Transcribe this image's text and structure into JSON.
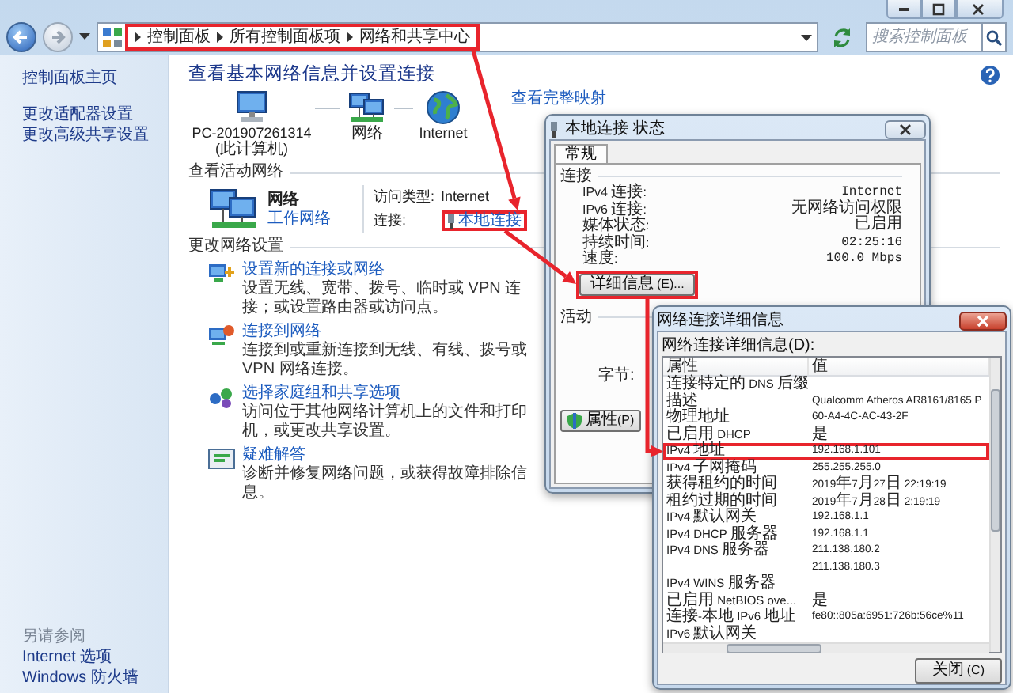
{
  "address_bar": {
    "breadcrumbs": [
      "控制面板",
      "所有控制面板项",
      "网络和共享中心"
    ],
    "highlighted": true
  },
  "search": {
    "placeholder": "搜索控制面板"
  },
  "sidebar": {
    "items": [
      "控制面板主页",
      "更改适配器设置",
      "更改高级共享设置"
    ],
    "see_also_title": "另请参阅",
    "see_also": [
      "Internet 选项",
      "Windows 防火墙"
    ]
  },
  "main": {
    "heading": "查看基本网络信息并设置连接",
    "map_link": "查看完整映射",
    "map_nodes": [
      {
        "kind": "computer",
        "label": [
          "PC-201907261314",
          "(此计算机)"
        ]
      },
      {
        "kind": "network",
        "label": [
          "网络"
        ]
      },
      {
        "kind": "internet",
        "label": [
          "Internet"
        ]
      }
    ],
    "active_networks": {
      "title": "查看活动网络",
      "network_name": "网络",
      "network_type": "工作网络",
      "access_label": "访问类型:",
      "access_value": "Internet",
      "connection_label": "连接:",
      "connection_value": "本地连接",
      "connection_highlighted": true
    },
    "change_settings": {
      "title": "更改网络设置",
      "tasks": [
        {
          "kind": "new-connection",
          "title": "设置新的连接或网络",
          "description": "设置无线、宽带、拨号、临时或 VPN 连接；或设置路由器或访问点。"
        },
        {
          "kind": "connect",
          "title": "连接到网络",
          "description": "连接到或重新连接到无线、有线、拨号或 VPN 网络连接。"
        },
        {
          "kind": "homegroup",
          "title": "选择家庭组和共享选项",
          "description": "访问位于其他网络计算机上的文件和打印机，或更改共享设置。"
        },
        {
          "kind": "troubleshoot",
          "title": "疑难解答",
          "description": "诊断并修复网络问题，或获得故障排除信息。"
        }
      ]
    }
  },
  "status_dialog": {
    "title": "本地连接 状态",
    "tabs": [
      {
        "label": "常规",
        "selected": true
      }
    ],
    "connection_title": "连接",
    "rows": [
      {
        "label": "IPv4 连接:",
        "value": "Internet"
      },
      {
        "label": "IPv6 连接:",
        "value": "无网络访问权限"
      },
      {
        "label": "媒体状态:",
        "value": "已启用"
      },
      {
        "label": "持续时间:",
        "value": "02:25:16"
      },
      {
        "label": "速度:",
        "value": "100.0 Mbps"
      }
    ],
    "details_button": "详细信息(E)...",
    "details_highlighted": true,
    "activity_title": "活动",
    "bytes_label": "字节:",
    "properties_button": "属性(P)"
  },
  "details_dialog": {
    "title": "网络连接详细信息",
    "list_label": "网络连接详细信息(D):",
    "columns": [
      "属性",
      "值"
    ],
    "rows": [
      {
        "property": "连接特定的 DNS 后缀",
        "highlighted": false
      },
      {
        "property": "描述",
        "value": "Qualcomm Atheros AR8161/8165 P",
        "highlighted": false
      },
      {
        "property": "物理地址",
        "value": "60-A4-4C-AC-43-2F",
        "highlighted": false
      },
      {
        "property": "已启用 DHCP",
        "value": "是",
        "highlighted": false
      },
      {
        "property": "IPv4 地址",
        "value": "192.168.1.101",
        "highlighted": true
      },
      {
        "property": "IPv4 子网掩码",
        "value": "255.255.255.0",
        "highlighted": false
      },
      {
        "property": "获得租约的时间",
        "value": "2019年7月27日 22:19:19",
        "highlighted": false
      },
      {
        "property": "租约过期的时间",
        "value": "2019年7月28日 2:19:19",
        "highlighted": false
      },
      {
        "property": "IPv4 默认网关",
        "value": "192.168.1.1",
        "highlighted": false
      },
      {
        "property": "IPv4 DHCP 服务器",
        "value": "192.168.1.1",
        "highlighted": false
      },
      {
        "property": "IPv4 DNS 服务器",
        "value": "211.138.180.2",
        "highlighted": false
      },
      {
        "value": "211.138.180.3",
        "highlighted": false
      },
      {
        "property": "IPv4 WINS 服务器",
        "highlighted": false
      },
      {
        "property": "已启用 NetBIOS ove...",
        "value": "是",
        "highlighted": false
      },
      {
        "property": "连接-本地 IPv6 地址",
        "value": "fe80::805a:6951:726b:56ce%11",
        "highlighted": false
      },
      {
        "property": "IPv6 默认网关",
        "highlighted": false
      }
    ],
    "close_button": "关闭(C)"
  }
}
